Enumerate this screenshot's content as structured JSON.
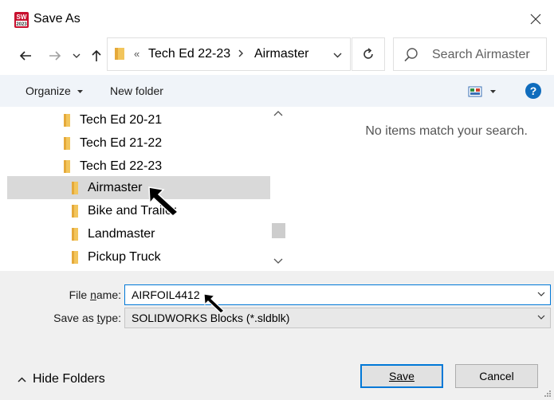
{
  "window": {
    "title": "Save As",
    "icon_text_top": "SW",
    "icon_text_bottom": "2023",
    "icon_color": "#c8102e"
  },
  "navigation": {
    "back_icon": "arrow-left-icon",
    "forward_icon": "arrow-right-icon",
    "recent_icon": "chevron-down-icon",
    "up_icon": "arrow-up-icon",
    "address": {
      "overflow": "«",
      "segments": [
        "Tech Ed 22-23",
        "Airmaster"
      ]
    },
    "search_placeholder": "Search Airmaster"
  },
  "commandbar": {
    "organize": "Organize",
    "new_folder": "New folder"
  },
  "help_label": "?",
  "folder_tree": [
    {
      "label": "Tech Ed 20-21",
      "level": 0,
      "selected": false
    },
    {
      "label": "Tech Ed 21-22",
      "level": 0,
      "selected": false
    },
    {
      "label": "Tech Ed 22-23",
      "level": 0,
      "selected": false
    },
    {
      "label": "Airmaster",
      "level": 1,
      "selected": true
    },
    {
      "label": "Bike and Trailer",
      "level": 1,
      "selected": false
    },
    {
      "label": "Landmaster",
      "level": 1,
      "selected": false
    },
    {
      "label": "Pickup Truck",
      "level": 1,
      "selected": false
    }
  ],
  "content": {
    "empty_message": "No items match your search."
  },
  "form": {
    "file_name_label": "File name:",
    "file_name_accel": "n",
    "file_name_value": "AIRFOIL4412",
    "save_type_label": "Save as type:",
    "save_type_accel": "t",
    "save_type_value": "SOLIDWORKS Blocks (*.sldblk)"
  },
  "footer": {
    "hide_folders": "Hide Folders",
    "save": "Save",
    "cancel": "Cancel"
  },
  "colors": {
    "accent": "#0078d7",
    "folder": "#f2c55c",
    "selection": "#d9d9d9",
    "commandbar": "#f0f4f9"
  }
}
